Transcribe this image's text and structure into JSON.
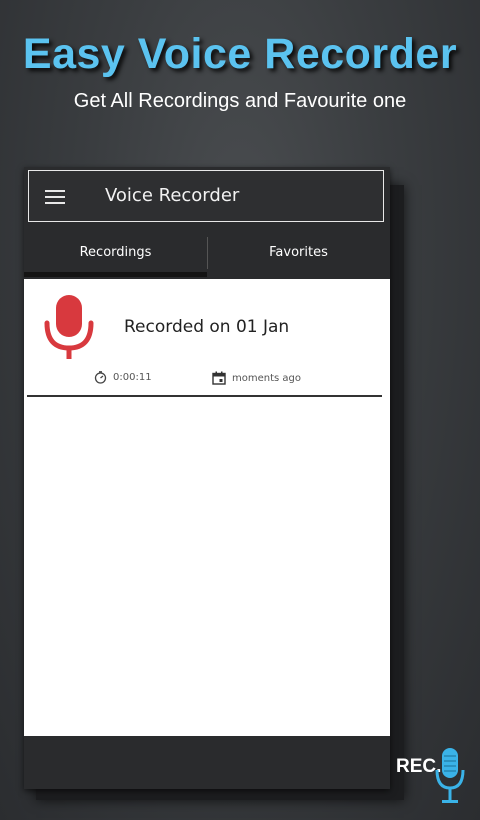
{
  "promo": {
    "title": "Easy Voice Recorder",
    "subtitle": "Get All Recordings and Favourite one"
  },
  "app_bar": {
    "title": "Voice Recorder",
    "menu_icon": "hamburger-menu-icon"
  },
  "tabs": [
    {
      "label": "Recordings",
      "selected": true
    },
    {
      "label": "Favorites",
      "selected": false
    }
  ],
  "recordings": [
    {
      "title": "Recorded on 01 Jan",
      "duration": "0:00:11",
      "date": "moments ago",
      "icon": "microphone-icon"
    }
  ],
  "logo": {
    "text": "REC."
  },
  "colors": {
    "title_blue": "#5bc3f0",
    "mic_red": "#d8393e",
    "logo_blue": "#3ab3e8"
  }
}
